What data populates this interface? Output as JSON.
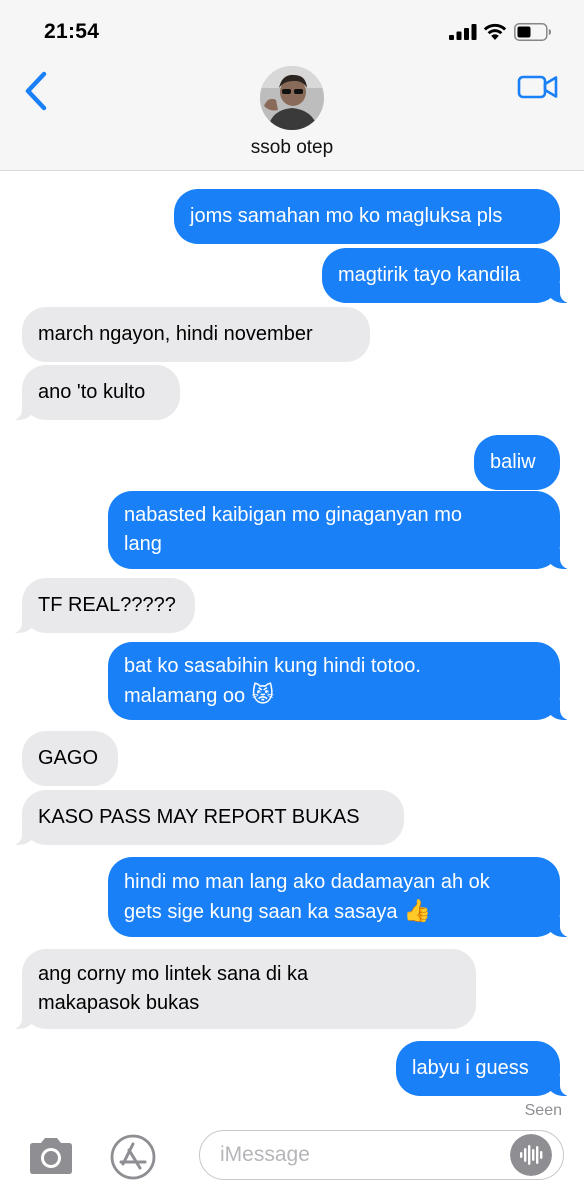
{
  "status_bar": {
    "time": "21:54"
  },
  "header": {
    "contact_name": "ssob otep"
  },
  "messages": [
    {
      "from": "me",
      "text": "joms samahan mo ko magluksa pls"
    },
    {
      "from": "me",
      "text": "magtirik tayo kandila"
    },
    {
      "from": "them",
      "text": "march ngayon, hindi november"
    },
    {
      "from": "them",
      "text": "ano 'to kulto"
    },
    {
      "from": "me",
      "text": "baliw"
    },
    {
      "from": "me",
      "line1": "nabasted kaibigan mo ginaganyan mo",
      "line2": "lang"
    },
    {
      "from": "them",
      "text": "TF REAL?????"
    },
    {
      "from": "me",
      "line1": "bat ko sasabihin kung hindi totoo.",
      "line2": "malamang oo",
      "emoji": "😾"
    },
    {
      "from": "them",
      "text": "GAGO"
    },
    {
      "from": "them",
      "text": "KASO PASS MAY REPORT BUKAS"
    },
    {
      "from": "me",
      "line1": "hindi mo man lang ako dadamayan ah ok",
      "line2": "gets sige kung saan ka sasaya",
      "emoji": "👍"
    },
    {
      "from": "them",
      "line1": "ang corny mo lintek sana di ka",
      "line2": "makapasok bukas"
    },
    {
      "from": "me",
      "text": "labyu i guess"
    }
  ],
  "read_receipt": "Seen",
  "composer": {
    "placeholder": "iMessage"
  },
  "icons": [
    "back-chevron-icon",
    "facetime-video-icon",
    "camera-icon",
    "app-store-icon",
    "audio-waveform-icon",
    "cellular-signal-icon",
    "wifi-icon",
    "battery-icon"
  ],
  "colors": {
    "sent_bubble": "#1a80f7",
    "received_bubble": "#e9e9eb",
    "accent": "#1a80f7"
  }
}
